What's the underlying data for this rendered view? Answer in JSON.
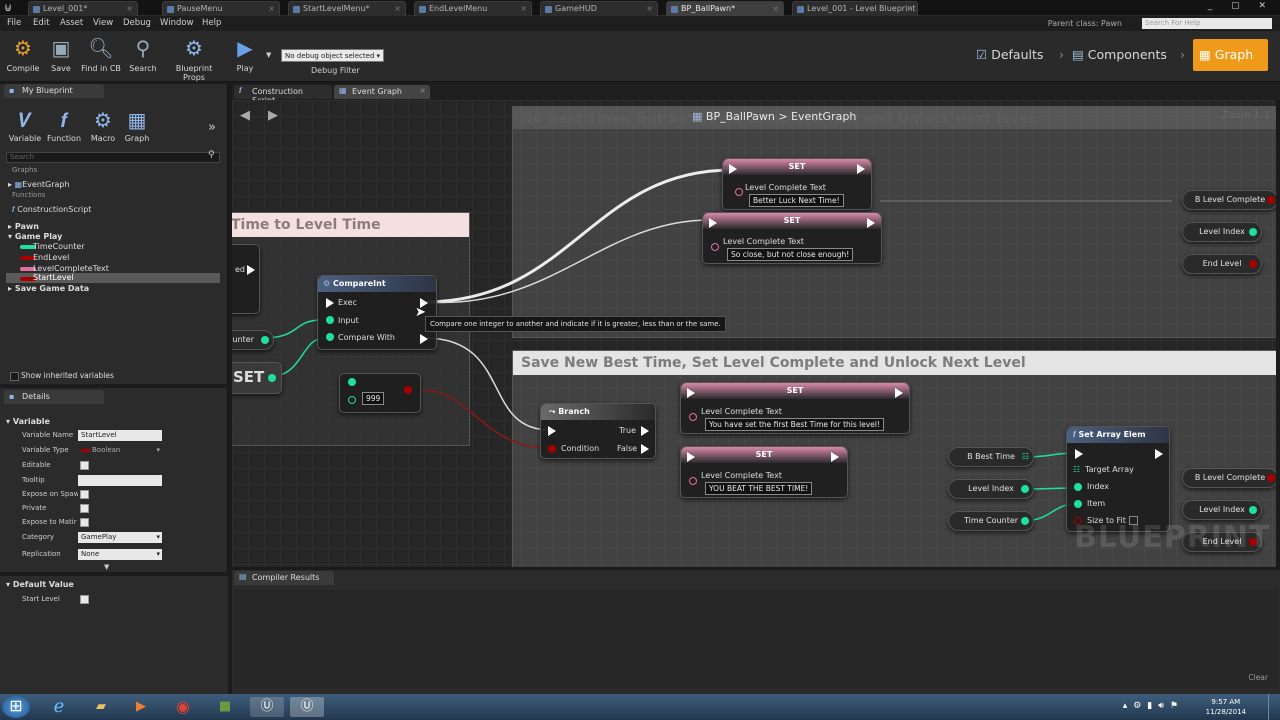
{
  "titlebar": {
    "tabs": [
      "Level_001*",
      "PauseMenu",
      "StartLevelMenu*",
      "EndLevelMenu",
      "GameHUD",
      "BP_BallPawn*",
      "Level_001 - Level Blueprint"
    ]
  },
  "menubar": {
    "items": [
      "File",
      "Edit",
      "Asset",
      "View",
      "Debug",
      "Window",
      "Help"
    ],
    "parent_class": "Parent class: Pawn",
    "search_placeholder": "Search For Help"
  },
  "toolbar": {
    "buttons": [
      "Compile",
      "Save",
      "Find in CB",
      "Search",
      "Blueprint Props",
      "Play"
    ],
    "debug_select": "No debug object selected",
    "debug_label": "Debug Filter"
  },
  "modes": {
    "defaults": "Defaults",
    "components": "Components",
    "graph": "Graph"
  },
  "my_blueprint": {
    "tab": "My Blueprint",
    "add_buttons": [
      "Variable",
      "Function",
      "Macro",
      "Graph"
    ],
    "search_placeholder": "Search",
    "tree": {
      "graphs_header": "Graphs",
      "event_graph": "EventGraph",
      "functions_header": "Functions",
      "construction_script": "ConstructionScript",
      "pawn": "Pawn",
      "game_play": "Game Play",
      "vars": [
        "TimeCounter",
        "EndLevel",
        "LevelCompleteText",
        "StartLevel"
      ],
      "save_game_data": "Save Game Data"
    },
    "show_inherited": "Show inherited variables"
  },
  "details": {
    "tab": "Details",
    "section": "Variable",
    "rows": {
      "name_label": "Variable Name",
      "name_value": "StartLevel",
      "type_label": "Variable Type",
      "type_value": "Boolean",
      "editable": "Editable",
      "tooltip": "Tooltip",
      "expose_spawn": "Expose on Spaw",
      "private": "Private",
      "expose_matinee": "Expose to Matir",
      "category_label": "Category",
      "category_value": "GamePlay",
      "replication_label": "Replication",
      "replication_value": "None"
    }
  },
  "default_value": {
    "section": "Default Value",
    "start_level": "Start Level"
  },
  "graph_tabs": [
    "Construction Script",
    "Event Graph"
  ],
  "graph": {
    "breadcrumb": "BP_BallPawn > EventGraph",
    "zoom": "Zoom 1:1",
    "watermark": "BLUEPRINT",
    "comments": {
      "top_right": "No Best Time, But Set Level Complete Text and Unlock next level.",
      "left": "Time to Level Time",
      "bottom_right": "Save New Best Time, Set Level Complete and Unlock Next Level"
    },
    "compare_node": {
      "title": "CompareInt",
      "pins": [
        "Exec",
        "Input",
        "Compare With"
      ]
    },
    "literal_999": "999",
    "left_partial": {
      "counter": "Counter",
      "set": "SET",
      "ed": "ed"
    },
    "set1": {
      "title": "SET",
      "pin": "Level Complete Text",
      "value": "Better Luck Next Time!"
    },
    "set2": {
      "title": "SET",
      "pin": "Level Complete Text",
      "value": "So close, but not close enough!"
    },
    "set3": {
      "title": "SET",
      "pin": "Level Complete Text",
      "value": "You have set the first Best Time for this level!"
    },
    "set4": {
      "title": "SET",
      "pin": "Level Complete Text",
      "value": "YOU BEAT THE BEST TIME!"
    },
    "branch": {
      "title": "Branch",
      "condition": "Condition",
      "true": "True",
      "false": "False"
    },
    "array_elem": {
      "title": "Set Array Elem",
      "pins": [
        "Target Array",
        "Index",
        "Item",
        "Size to Fit"
      ]
    },
    "getters_top": [
      "B Level Complete",
      "Level Index",
      "End Level"
    ],
    "getters_bottom": [
      "B Best Time",
      "Level Index",
      "Time Counter"
    ],
    "getters_bottom_right": [
      "B Level Complete",
      "Level Index",
      "End Level"
    ],
    "tooltip": "Compare one integer to another and indicate if it is greater, less than or the same."
  },
  "compiler": {
    "tab": "Compiler Results",
    "clear": "Clear"
  },
  "taskbar": {
    "time": "9:57 AM",
    "date": "11/28/2014"
  },
  "colors": {
    "accent": "#f09a1a",
    "bool": "#a80000",
    "int": "#1fe0a0",
    "string": "#ff66cc",
    "exec": "#ffffff"
  }
}
